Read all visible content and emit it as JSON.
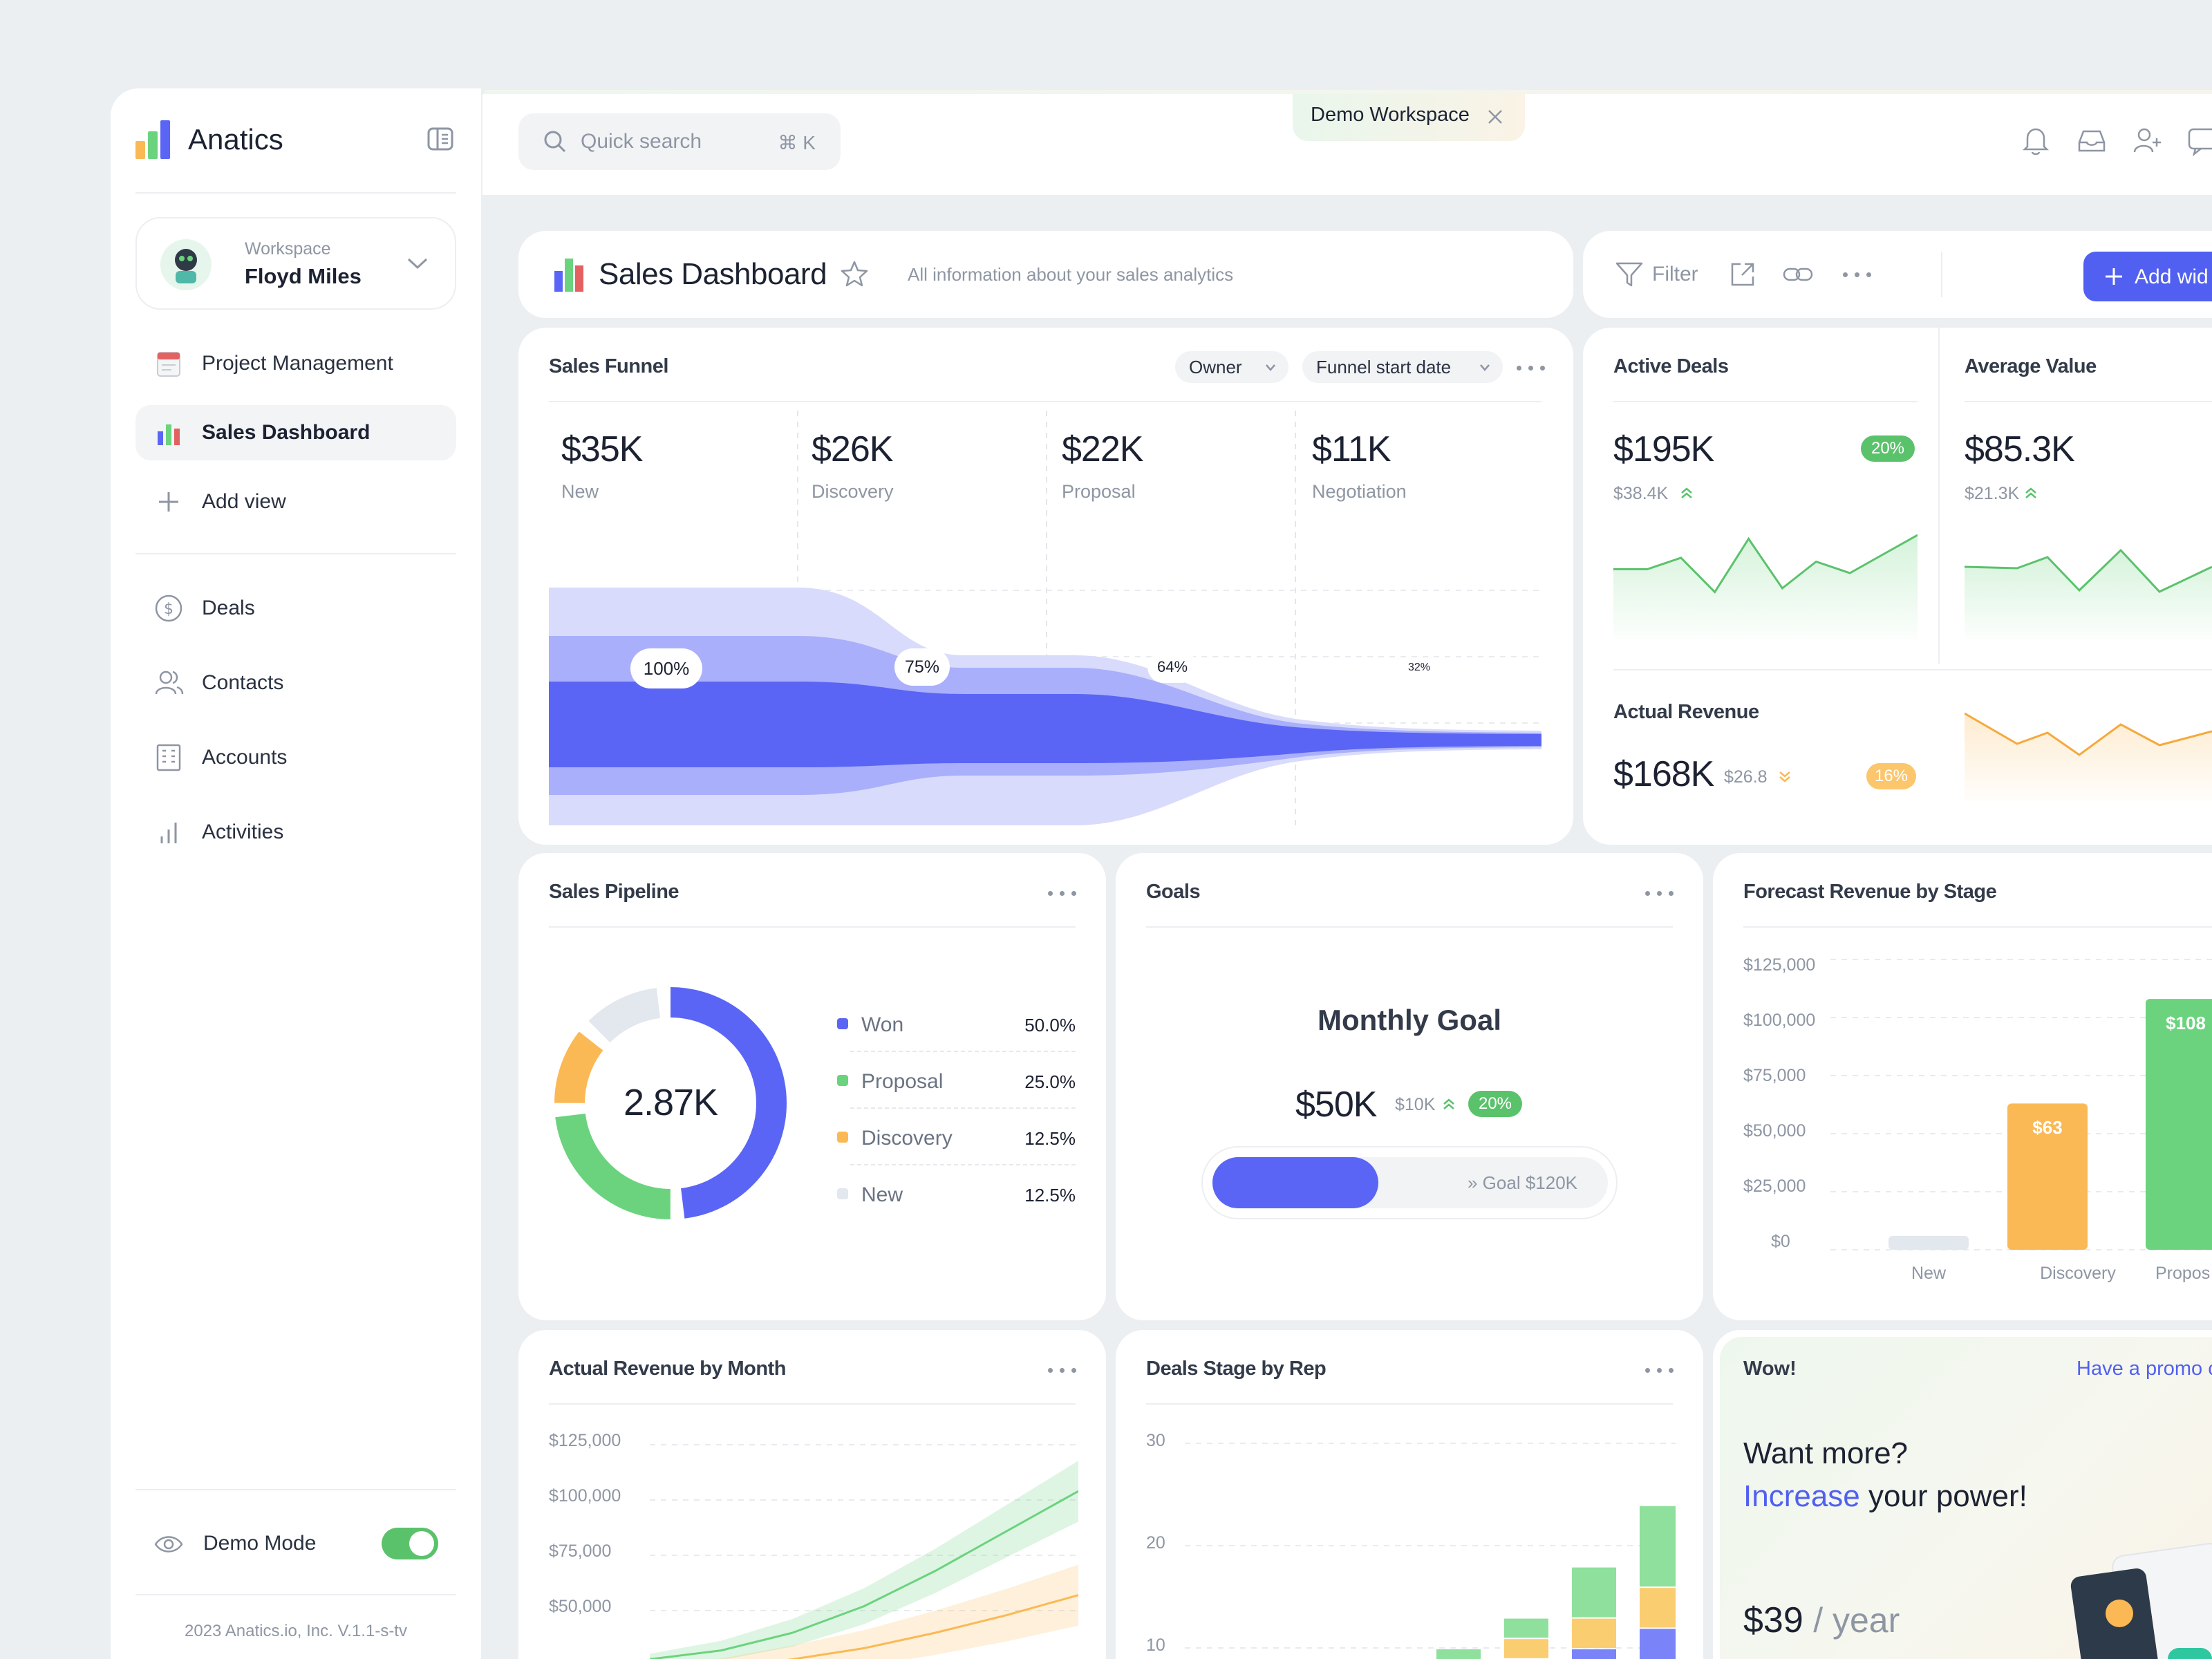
{
  "app": {
    "name": "Anatics"
  },
  "workspace": {
    "caption": "Workspace",
    "name": "Floyd Miles"
  },
  "sidebar": {
    "views": [
      {
        "label": "Project Management",
        "icon": "calendar-icon"
      },
      {
        "label": "Sales Dashboard",
        "icon": "bar-chart-icon",
        "active": true
      },
      {
        "label": "Add view",
        "icon": "plus-icon"
      }
    ],
    "nav": [
      {
        "label": "Deals",
        "icon": "dollar-icon"
      },
      {
        "label": "Contacts",
        "icon": "users-icon"
      },
      {
        "label": "Accounts",
        "icon": "building-icon"
      },
      {
        "label": "Activities",
        "icon": "activity-bars-icon"
      }
    ],
    "demo_mode": {
      "label": "Demo Mode",
      "on": true
    },
    "footer": "2023 Anatics.io, Inc. V.1.1-s-tv"
  },
  "topbar": {
    "search_placeholder": "Quick search",
    "search_shortcut": "⌘ K",
    "workspace_tag": "Demo Workspace"
  },
  "header": {
    "title": "Sales Dashboard",
    "subtitle": "All information about your sales analytics",
    "filter_label": "Filter",
    "add_widget_label": "Add wid"
  },
  "funnel": {
    "title": "Sales Funnel",
    "filters": [
      "Owner",
      "Funnel start date"
    ],
    "stages": [
      {
        "value": "$35K",
        "name": "New",
        "pct": "100%"
      },
      {
        "value": "$26K",
        "name": "Discovery",
        "pct": "75%"
      },
      {
        "value": "$22K",
        "name": "Proposal",
        "pct": "64%"
      },
      {
        "value": "$11K",
        "name": "Negotiation",
        "pct": "32%"
      }
    ],
    "colors": [
      "#d8dbfb",
      "#a9affa",
      "#5a65f5"
    ]
  },
  "active_deals": {
    "title": "Active Deals",
    "value": "$195K",
    "sub": "$38.4K",
    "badge": "20%",
    "trend": [
      0.45,
      0.45,
      0.3,
      0.75,
      0.05,
      0.7,
      0.35,
      0.5,
      0.25,
      0.0
    ]
  },
  "average_value": {
    "title": "Average Value",
    "value": "$85.3K",
    "sub": "$21.3K"
  },
  "actual_revenue": {
    "title": "Actual Revenue",
    "value": "$168K",
    "sub": "$26.8",
    "badge": "16%"
  },
  "pipeline": {
    "title": "Sales Pipeline",
    "center": "2.87K",
    "items": [
      {
        "name": "Won",
        "pct": "50.0%",
        "share": 50.0,
        "color": "#5a65f5"
      },
      {
        "name": "Proposal",
        "pct": "25.0%",
        "share": 25.0,
        "color": "#6bd37e"
      },
      {
        "name": "Discovery",
        "pct": "12.5%",
        "share": 12.5,
        "color": "#fbb955"
      },
      {
        "name": "New",
        "pct": "12.5%",
        "share": 12.5,
        "color": "#e3e7ee"
      }
    ]
  },
  "goals": {
    "title": "Goals",
    "heading": "Monthly Goal",
    "value": "$50K",
    "sub": "$10K",
    "badge": "20%",
    "goal_label": "Goal $120K",
    "progress": 0.42
  },
  "chart_data": [
    {
      "type": "bar",
      "title": "Forecast Revenue by Stage",
      "categories": [
        "New",
        "Discovery",
        "Propos"
      ],
      "values": [
        6000,
        63000,
        108000
      ],
      "data_labels": [
        "",
        "$63",
        "$108"
      ],
      "colors": [
        "#e3e7ee",
        "#fbb955",
        "#6bd37e"
      ],
      "yticks": [
        "$125,000",
        "$100,000",
        "$75,000",
        "$50,000",
        "$25,000",
        "$0"
      ],
      "ylim": [
        0,
        125000
      ]
    },
    {
      "type": "line",
      "title": "Actual Revenue by Month",
      "yticks": [
        "$125,000",
        "$100,000",
        "$75,000",
        "$50,000"
      ],
      "ylim": [
        25000,
        125000
      ],
      "series": [
        {
          "color": "#6bd37e",
          "values": [
            28000,
            32000,
            40000,
            52000,
            68000,
            86000,
            104000
          ]
        },
        {
          "color": "#fbb955",
          "values": [
            22000,
            24000,
            28000,
            33000,
            40000,
            48000,
            57000
          ]
        }
      ]
    },
    {
      "type": "bar",
      "title": "Deals Stage by Rep",
      "yticks": [
        "30",
        "20",
        "10"
      ],
      "ylim": [
        8,
        32
      ],
      "stack_colors": [
        "#7a83f7",
        "#fbcd71",
        "#8ee09c"
      ],
      "stacks": [
        [
          0,
          0,
          2
        ],
        [
          1,
          2,
          2
        ],
        [
          2,
          3,
          5
        ],
        [
          4,
          4,
          8
        ]
      ]
    }
  ],
  "promo": {
    "title": "Wow!",
    "link": "Have a promo c",
    "line1": "Want more?",
    "line2_accent": "Increase",
    "line2_rest": "your power!",
    "price": "$39",
    "period": "/ year"
  }
}
